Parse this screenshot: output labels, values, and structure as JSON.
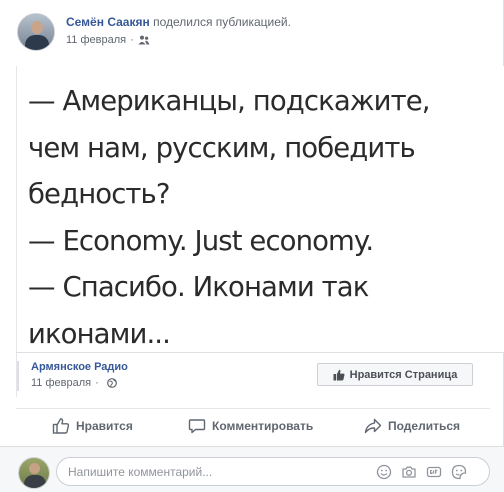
{
  "post": {
    "author": "Семён Саакян",
    "action": "поделился публикацией.",
    "date": "11 февраля",
    "separator": "·",
    "privacy_icon": "friends-icon"
  },
  "image_text": {
    "lines": [
      "— Американцы, подскажите,",
      "чем нам, русским, победить",
      "бедность?",
      "— Economy. Just economy.",
      "— Спасибо. Иконами так",
      "иконами..."
    ]
  },
  "shared": {
    "page_name": "Армянское Радио",
    "date": "11 февраля",
    "separator": "·",
    "privacy_icon": "globe-icon",
    "like_page_label": "Нравится Страница"
  },
  "actions": {
    "like": "Нравится",
    "comment": "Комментировать",
    "share": "Поделиться"
  },
  "comment_box": {
    "placeholder": "Напишите комментарий...",
    "icons": [
      "emoji-icon",
      "camera-icon",
      "gif-icon",
      "sticker-icon"
    ]
  },
  "colors": {
    "link": "#365899",
    "muted": "#616770",
    "action": "#606770"
  }
}
